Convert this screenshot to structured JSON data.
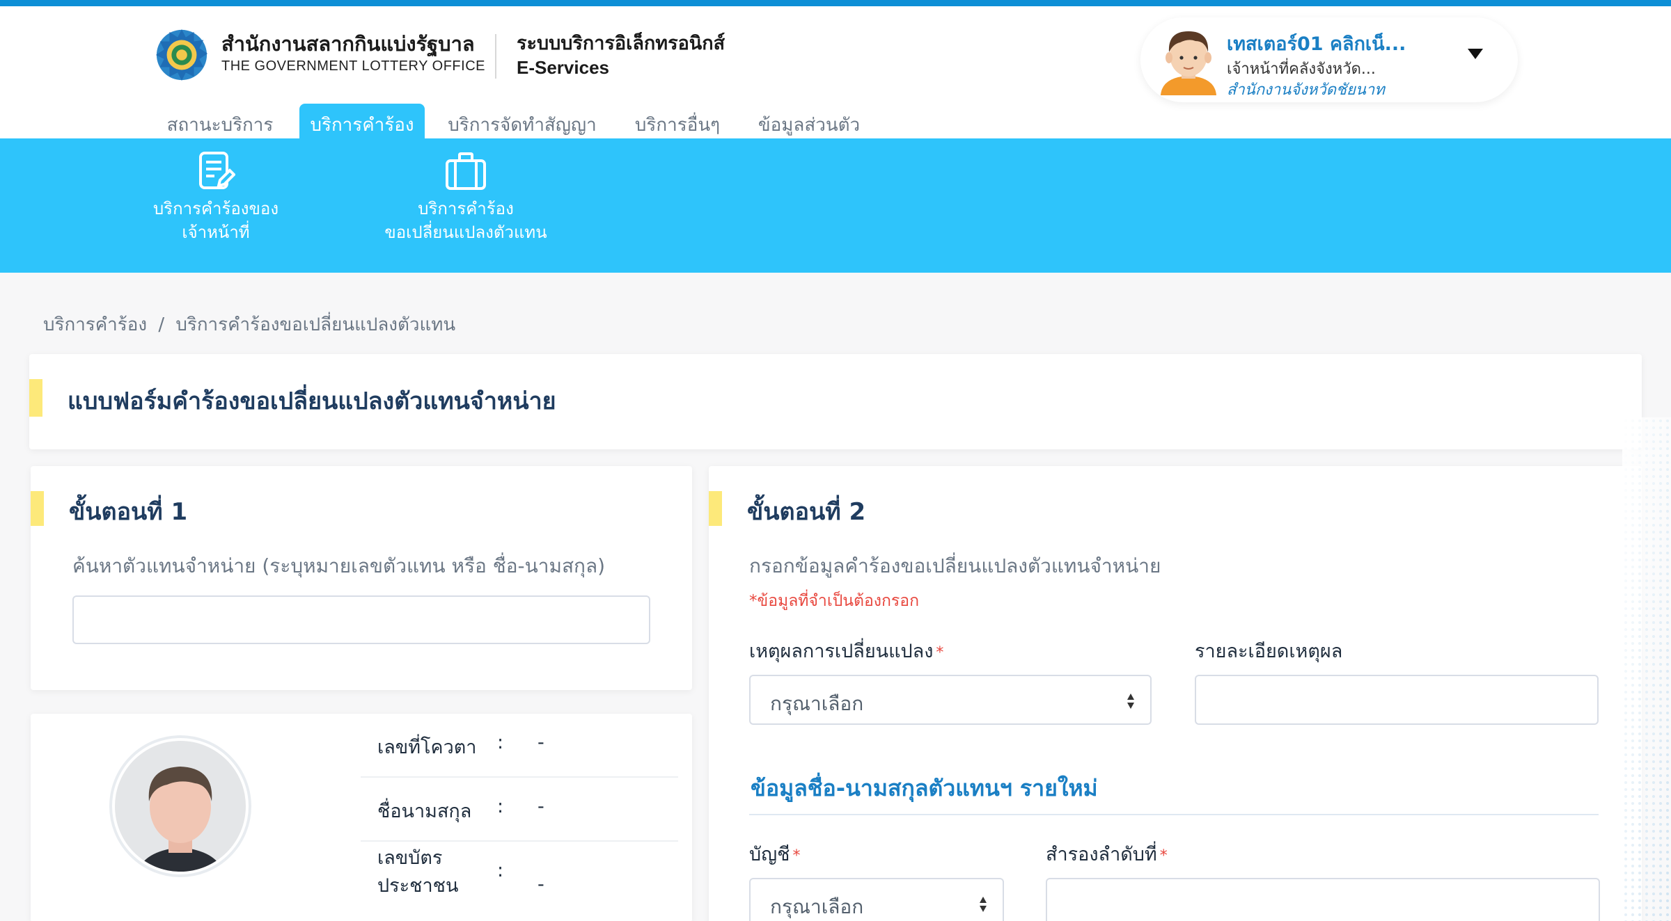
{
  "header": {
    "org_name_th": "สำนักงานสลากกินแบ่งรัฐบาล",
    "org_name_en": "THE GOVERNMENT LOTTERY OFFICE",
    "system_name_th": "ระบบบริการอิเล็กทรอนิกส์",
    "system_name_en": "E-Services",
    "user": {
      "name": "เทสเตอร์01 คลิกเน็...",
      "role": "เจ้าหน้าที่คลังจังหวัด...",
      "office": "สำนักงานจังหวัดชัยนาท"
    }
  },
  "nav": {
    "items": [
      {
        "label": "สถานะบริการ"
      },
      {
        "label": "บริการคำร้อง"
      },
      {
        "label": "บริการจัดทำสัญญา"
      },
      {
        "label": "บริการอื่นๆ"
      },
      {
        "label": "ข้อมูลส่วนตัว"
      }
    ],
    "active_index": 1
  },
  "subnav": {
    "items": [
      {
        "line1": "บริการคำร้องของ",
        "line2": "เจ้าหน้าที่",
        "icon": "document-edit-icon"
      },
      {
        "line1": "บริการคำร้อง",
        "line2": "ขอเปลี่ยนแปลงตัวแทน",
        "icon": "briefcase-icon"
      }
    ]
  },
  "breadcrumb": {
    "items": [
      "บริการคำร้อง",
      "/",
      "บริการคำร้องขอเปลี่ยนแปลงตัวแทน"
    ]
  },
  "form": {
    "title": "แบบฟอร์มคำร้องขอเปลี่ยนแปลงตัวแทนจำหน่าย"
  },
  "step1": {
    "title": "ขั้นตอนที่ 1",
    "search_label": "ค้นหาตัวแทนจำหน่าย (ระบุหมายเลขตัวแทน หรือ ชื่อ-นามสกุล)",
    "search_value": ""
  },
  "profile": {
    "rows": [
      {
        "label": "เลขที่โควตา",
        "colon": ":",
        "value": "-"
      },
      {
        "label": "ชื่อนามสกุล",
        "colon": ":",
        "value": "-"
      },
      {
        "label": "เลขบัตร",
        "label2": "ประชาชน",
        "colon": ":",
        "value": "-"
      }
    ]
  },
  "step2": {
    "title": "ขั้นตอนที่ 2",
    "subtitle": "กรอกข้อมูลคำร้องขอเปลี่ยนแปลงตัวแทนจำหน่าย",
    "required_note": "*ข้อมูลที่จำเป็นต้องกรอก",
    "reason_label": "เหตุผลการเปลี่ยนแปลง",
    "reason_placeholder": "กรุณาเลือก",
    "reason_detail_label": "รายละเอียดเหตุผล",
    "reason_detail_value": "",
    "new_agent_section": "ข้อมูลชื่อ-นามสกุลตัวแทนฯ รายใหม่",
    "account_label": "บัญชี",
    "account_placeholder": "กรุณาเลือก",
    "reserve_label": "สำรองลำดับที่",
    "reserve_value": "",
    "required_star": "*"
  },
  "colors": {
    "topline": "#0e8fd6",
    "accent_blue": "#2ec4fb",
    "link_blue": "#1a7fc4",
    "accent_yellow": "#fde97a",
    "required_red": "#e8483f"
  }
}
